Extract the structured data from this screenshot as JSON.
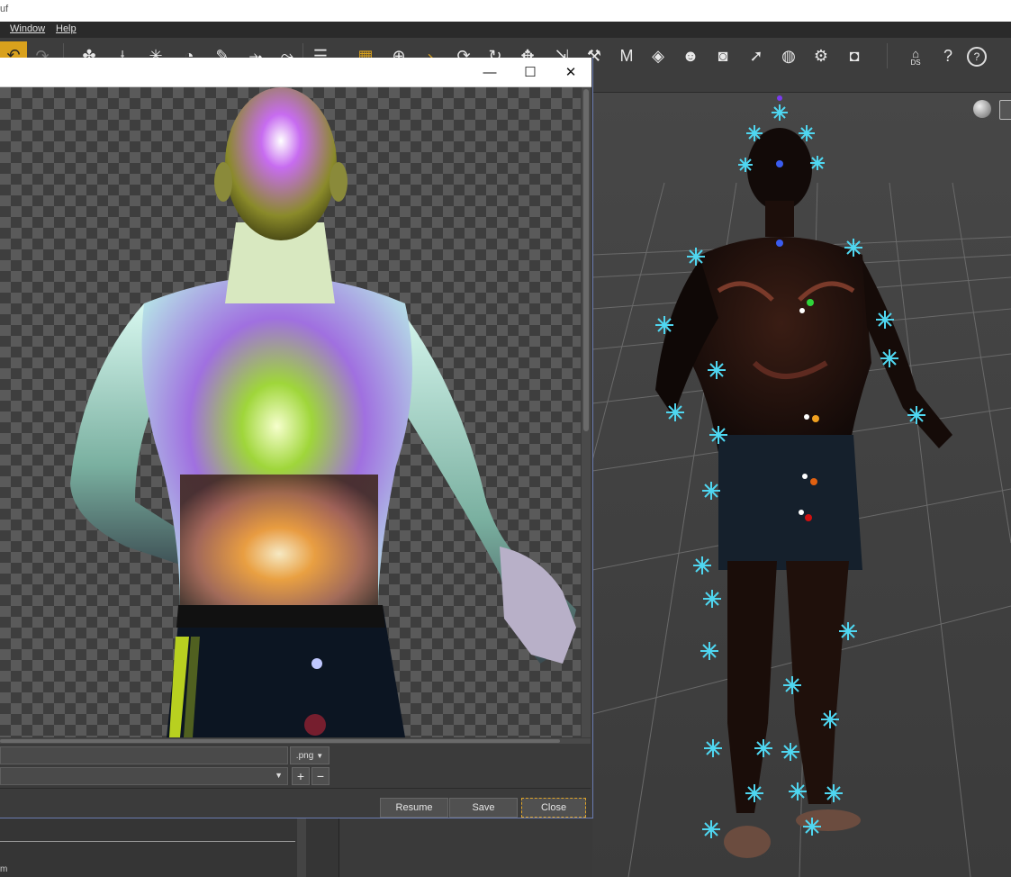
{
  "app": {
    "title_fragment": "uf"
  },
  "menu": {
    "items": [
      "Window",
      "Help"
    ]
  },
  "toolbar": {
    "undo_icon": "undo-arrow-icon",
    "icons": [
      "node-add-icon",
      "joint-add-icon",
      "spark-tool-icon",
      "gauge-tool-icon",
      "paint-tool-icon",
      "node-weight-icon",
      "bone-edit-icon",
      "panel-icon",
      "grid-icon",
      "universal-tool-icon",
      "angle-tool-icon",
      "rotate-tool-icon",
      "rotate2-tool-icon",
      "move-tool-icon",
      "scale-tool-icon",
      "joint-tool-icon",
      "morph-tool-icon",
      "surface-tool-icon",
      "figure-tool-icon",
      "camera-tool-icon",
      "select-tool-icon",
      "sphere-tool-icon",
      "gear-camera-icon",
      "render-camera-icon",
      "home-icon",
      "help-pointer-icon",
      "help-icon"
    ],
    "ds_badge": "DS"
  },
  "dialog": {
    "ext_value": ".png",
    "resume_label": "Resume",
    "save_label": "Save",
    "close_label": "Close",
    "plus_label": "+",
    "minus_label": "−"
  },
  "left_panel": {
    "tiny_text": "m"
  },
  "colors": {
    "accent": "#d9a11c",
    "node_marker": "#4fd6f0",
    "focus_border": "#e0a428"
  }
}
